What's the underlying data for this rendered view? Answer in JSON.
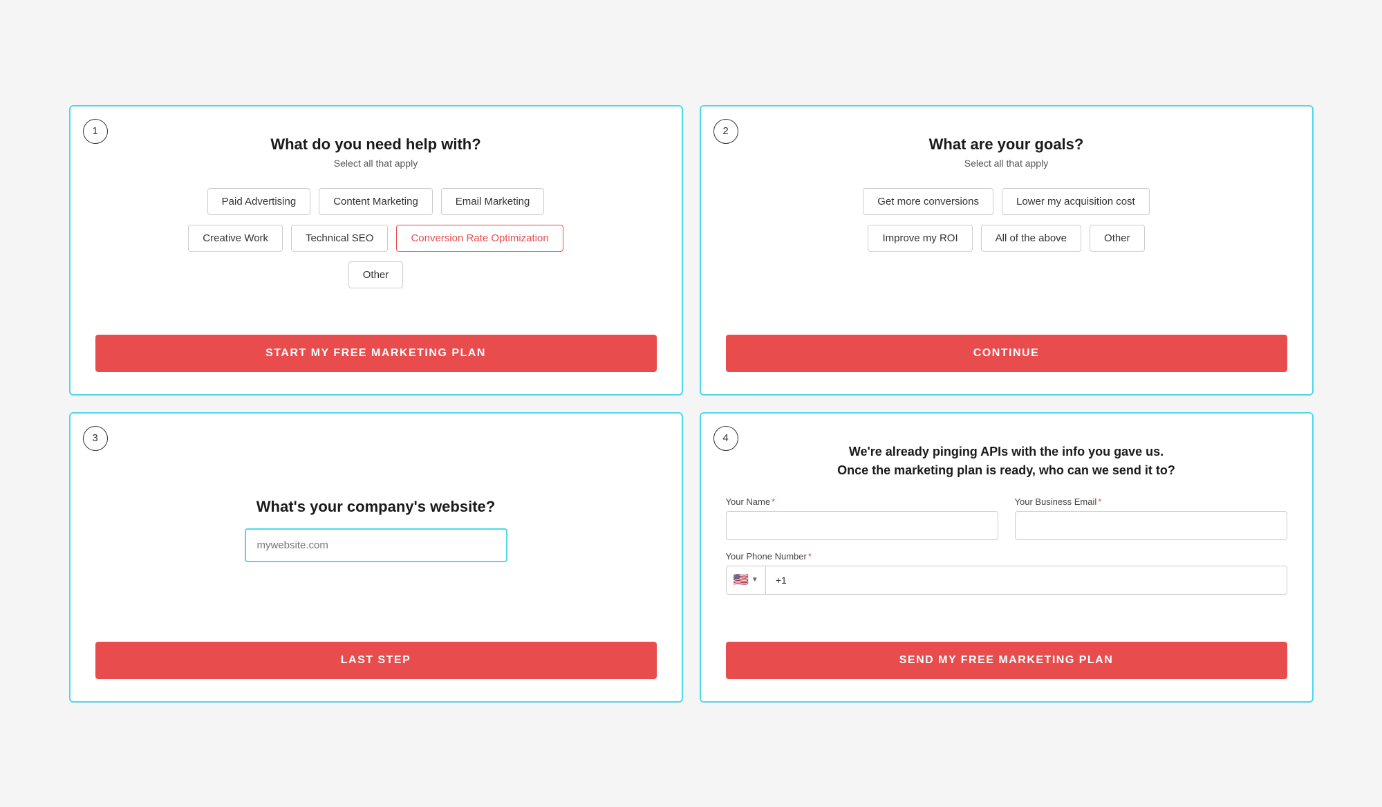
{
  "card1": {
    "step": "1",
    "title": "What do you need help with?",
    "subtitle": "Select all that apply",
    "options_row1": [
      "Paid Advertising",
      "Content Marketing",
      "Email Marketing"
    ],
    "options_row2": [
      "Creative Work",
      "Technical SEO",
      "Conversion Rate Optimization"
    ],
    "options_row3": [
      "Other"
    ],
    "selected": "Conversion Rate Optimization",
    "cta": "START MY FREE MARKETING PLAN"
  },
  "card2": {
    "step": "2",
    "title": "What are your goals?",
    "subtitle": "Select all that apply",
    "options_row1": [
      "Get more conversions",
      "Lower my acquisition cost"
    ],
    "options_row2": [
      "Improve my ROI",
      "All of the above",
      "Other"
    ],
    "cta": "CONTINUE"
  },
  "card3": {
    "step": "3",
    "label": "What's your company's website?",
    "placeholder": "mywebsite.com",
    "cta": "LAST STEP"
  },
  "card4": {
    "step": "4",
    "header_line1": "We're already pinging APIs with the info you gave us.",
    "header_line2": "Once the marketing plan is ready, who can we send it to?",
    "name_label": "Your Name",
    "email_label": "Your Business Email",
    "phone_label": "Your Phone Number",
    "flag_emoji": "🇺🇸",
    "phone_prefix": "+1",
    "cta": "SEND MY FREE MARKETING PLAN"
  }
}
